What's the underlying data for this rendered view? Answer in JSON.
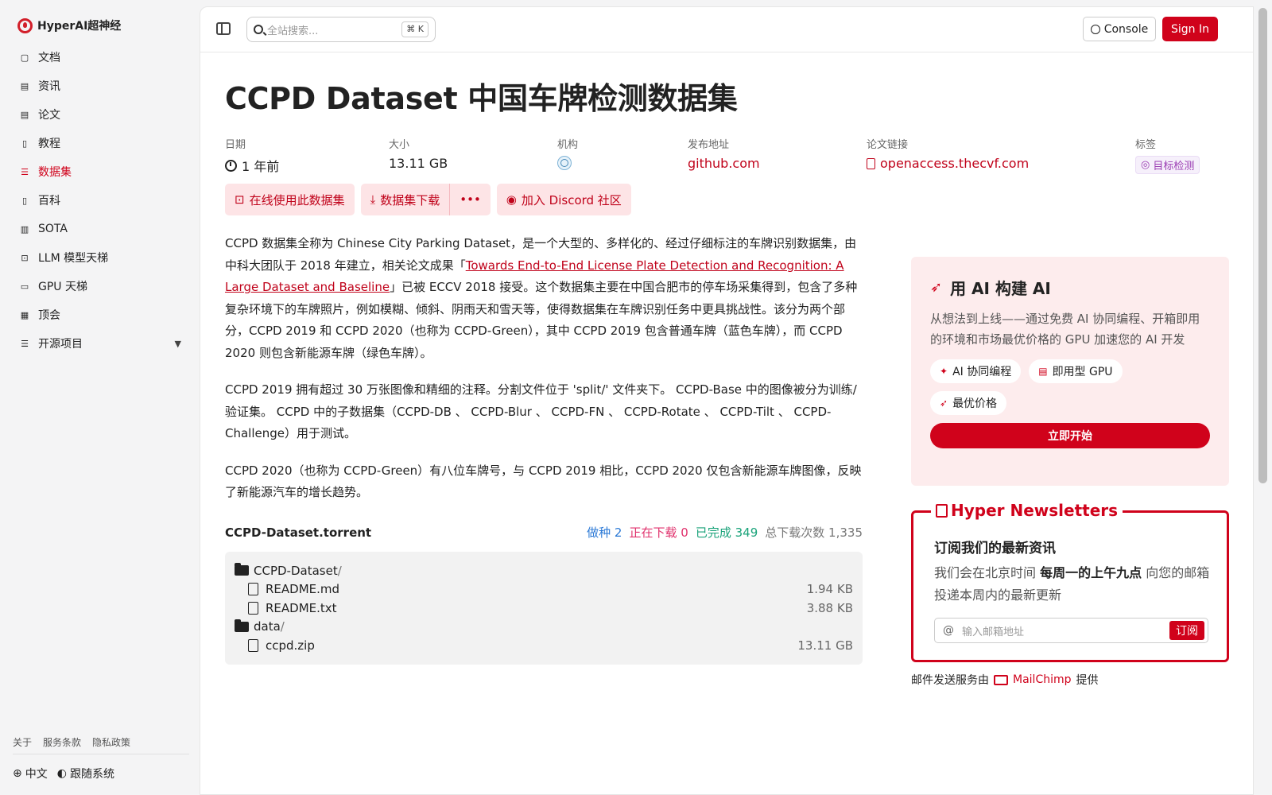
{
  "brand": {
    "name": "HyperAI超神经"
  },
  "sidebar": {
    "items": [
      {
        "label": "文档",
        "icon": "doc-icon",
        "active": false
      },
      {
        "label": "资讯",
        "icon": "news-icon",
        "active": false
      },
      {
        "label": "论文",
        "icon": "paper-icon",
        "active": false
      },
      {
        "label": "教程",
        "icon": "book-icon",
        "active": false
      },
      {
        "label": "数据集",
        "icon": "database-icon",
        "active": true
      },
      {
        "label": "百科",
        "icon": "wiki-icon",
        "active": false
      },
      {
        "label": "SOTA",
        "icon": "chart-icon",
        "active": false
      },
      {
        "label": "LLM 模型天梯",
        "icon": "cpu-icon",
        "active": false
      },
      {
        "label": "GPU 天梯",
        "icon": "monitor-icon",
        "active": false
      },
      {
        "label": "顶会",
        "icon": "calendar-icon",
        "active": false
      },
      {
        "label": "开源项目",
        "icon": "list-icon",
        "active": false,
        "expandable": true
      }
    ],
    "footer_links": [
      "关于",
      "服务条款",
      "隐私政策"
    ],
    "language": "中文",
    "theme": "跟随系统"
  },
  "topbar": {
    "search_placeholder": "全站搜索...",
    "search_shortcut": "K",
    "console_label": "Console",
    "signin_label": "Sign In"
  },
  "dataset": {
    "title": "CCPD Dataset 中国车牌检测数据集",
    "meta": {
      "date_label": "日期",
      "date_value": "1 年前",
      "size_label": "大小",
      "size_value": "13.11 GB",
      "org_label": "机构",
      "release_label": "发布地址",
      "release_value": "github.com",
      "paper_label": "论文链接",
      "paper_value": "openaccess.thecvf.com",
      "tags_label": "标签",
      "tag_value": "目标检测"
    },
    "actions": {
      "use_online": "在线使用此数据集",
      "download": "数据集下载",
      "more": "•••",
      "discord": "加入 Discord 社区"
    },
    "desc": {
      "p1_pre": "CCPD 数据集全称为 Chinese City Parking Dataset，是一个大型的、多样化的、经过仔细标注的车牌识别数据集，由中科大团队于 2018 年建立，相关论文成果「",
      "p1_link": "Towards End-to-End License Plate Detection and Recognition: A Large Dataset and Baseline",
      "p1_post": "」已被 ECCV 2018 接受。这个数据集主要在中国合肥市的停车场采集得到，包含了多种复杂环境下的车牌照片，例如模糊、倾斜、阴雨天和雪天等，使得数据集在车牌识别任务中更具挑战性。该分为两个部分，CCPD 2019 和 CCPD 2020（也称为 CCPD-Green），其中 CCPD 2019 包含普通车牌（蓝色车牌），而 CCPD 2020 则包含新能源车牌（绿色车牌）。",
      "p2": "CCPD 2019 拥有超过 30 万张图像和精细的注释。分割文件位于 'split/' 文件夹下。 CCPD-Base 中的图像被分为训练/验证集。 CCPD 中的子数据集（CCPD-DB 、 CCPD-Blur 、 CCPD-FN 、 CCPD-Rotate 、 CCPD-Tilt 、 CCPD-Challenge）用于测试。",
      "p3": "CCPD 2020（也称为 CCPD-Green）有八位车牌号，与 CCPD 2019 相比，CCPD 2020 仅包含新能源车牌图像，反映了新能源汽车的增长趋势。"
    },
    "torrent": {
      "name": "CCPD-Dataset.torrent",
      "seeding_label": "做种",
      "seeding": "2",
      "downloading_label": "正在下载",
      "downloading": "0",
      "completed_label": "已完成",
      "completed": "349",
      "total_label": "总下载次数",
      "total": "1,335"
    },
    "files": [
      {
        "type": "folder",
        "name": "CCPD-Dataset",
        "size": ""
      },
      {
        "type": "file",
        "name": "README.md",
        "size": "1.94 KB"
      },
      {
        "type": "file",
        "name": "README.txt",
        "size": "3.88 KB"
      },
      {
        "type": "folder",
        "name": "data",
        "size": ""
      },
      {
        "type": "file",
        "name": "ccpd.zip",
        "size": "13.11 GB"
      }
    ]
  },
  "promo": {
    "title": "用 AI 构建 AI",
    "text": "从想法到上线——通过免费 AI 协同编程、开箱即用的环境和市场最优价格的 GPU 加速您的 AI 开发",
    "chips": [
      "AI 协同编程",
      "即用型 GPU",
      "最优价格"
    ],
    "cta": "立即开始"
  },
  "newsletter": {
    "legend": "Hyper Newsletters",
    "subtitle": "订阅我们的最新资讯",
    "text_pre": "我们会在北京时间 ",
    "text_bold": "每周一的上午九点",
    "text_post": " 向您的邮箱投递本周内的最新更新",
    "email_placeholder": "输入邮箱地址",
    "subscribe": "订阅",
    "note_pre": "邮件发送服务由",
    "note_brand": "MailChimp",
    "note_post": "提供"
  }
}
